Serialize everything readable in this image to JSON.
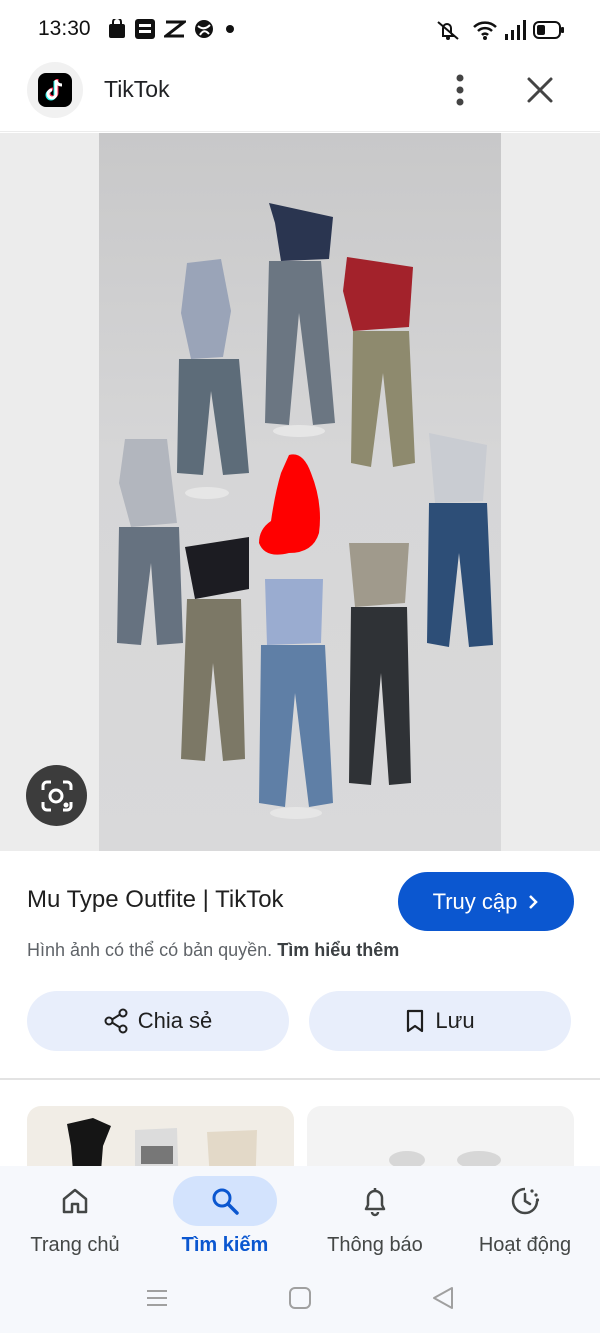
{
  "status_bar": {
    "time": "13:30"
  },
  "header": {
    "app_name": "TikTok"
  },
  "preview": {
    "description_icon": "lens-icon"
  },
  "result": {
    "title": "Mu Type Outfite | TikTok",
    "visit_label": "Truy cập",
    "copyright_text": "Hình ảnh có thể có bản quyền.",
    "learn_more": "Tìm hiểu thêm"
  },
  "actions": {
    "share_label": "Chia sẻ",
    "save_label": "Lưu"
  },
  "bottom_nav": {
    "items": [
      {
        "label": "Trang chủ",
        "icon": "home-icon"
      },
      {
        "label": "Tìm kiếm",
        "icon": "search-icon"
      },
      {
        "label": "Thông báo",
        "icon": "bell-icon"
      },
      {
        "label": "Hoạt động",
        "icon": "history-icon"
      }
    ]
  },
  "colors": {
    "accent": "#0b57d0",
    "pill_bg": "#e8eefb",
    "nav_bg": "#f6f8fc"
  }
}
